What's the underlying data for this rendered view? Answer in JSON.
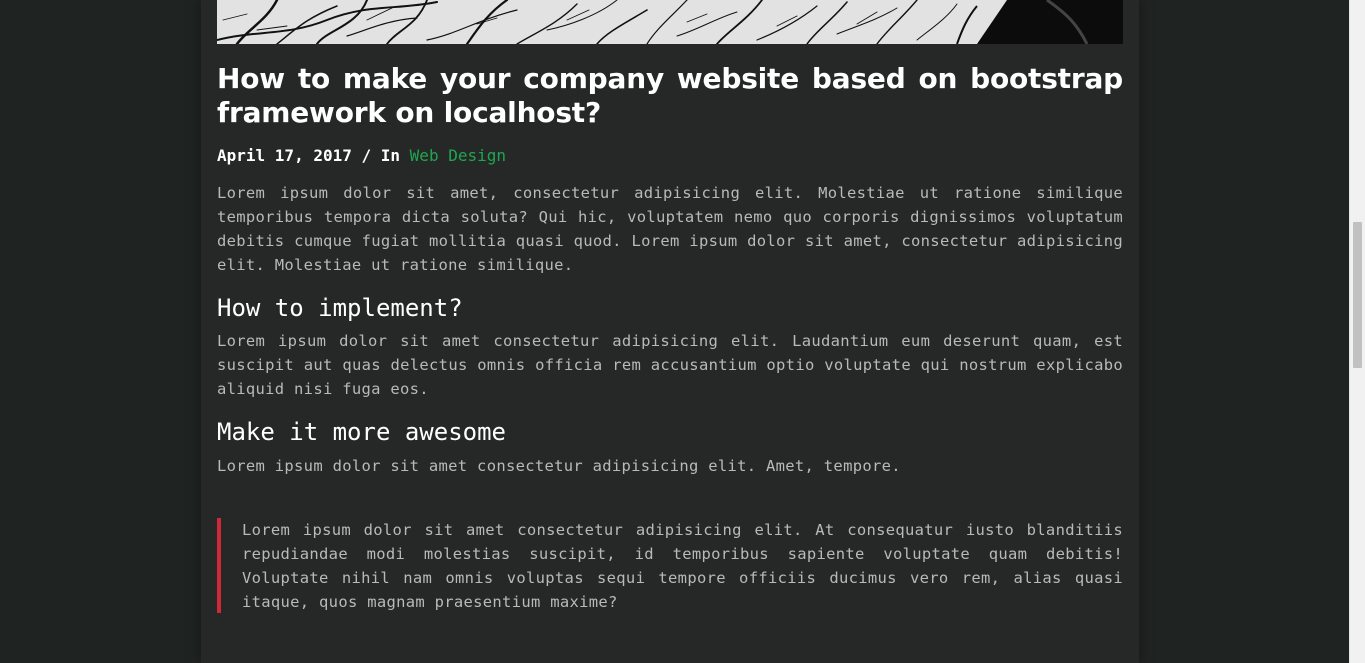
{
  "post": {
    "title": "How to make your company website based on bootstrap framework on localhost?",
    "date": "April 17, 2017",
    "separator": "/ In",
    "category": "Web Design",
    "intro": "Lorem ipsum dolor sit amet, consectetur adipisicing elit. Molestiae ut ratione similique temporibus tempora dicta soluta? Qui hic, voluptatem nemo quo corporis dignissimos voluptatum debitis cumque fugiat mollitia quasi quod. Lorem ipsum dolor sit amet, consectetur adipisicing elit. Molestiae ut ratione similique.",
    "section1": {
      "heading": "How to implement?",
      "body": "Lorem ipsum dolor sit amet consectetur adipisicing elit. Laudantium eum deserunt quam, est suscipit aut quas delectus omnis officia rem accusantium optio voluptate qui nostrum explicabo aliquid nisi fuga eos."
    },
    "section2": {
      "heading": "Make it more awesome",
      "body": "Lorem ipsum dolor sit amet consectetur adipisicing elit. Amet, tempore."
    },
    "quote": "Lorem ipsum dolor sit amet consectetur adipisicing elit. At consequatur iusto blanditiis repudiandae modi molestias suscipit, id temporibus sapiente voluptate quam debitis! Voluptate nihil nam omnis voluptas sequi tempore officiis ducimus vero rem, alias quasi itaque, quos magnam praesentium maxime?"
  },
  "colors": {
    "background": "#1f2322",
    "card": "#252827",
    "accent_link": "#1fa64f",
    "quote_border": "#d0283b"
  },
  "icons": {
    "hero_image": "bare-tree-branches-photo"
  }
}
